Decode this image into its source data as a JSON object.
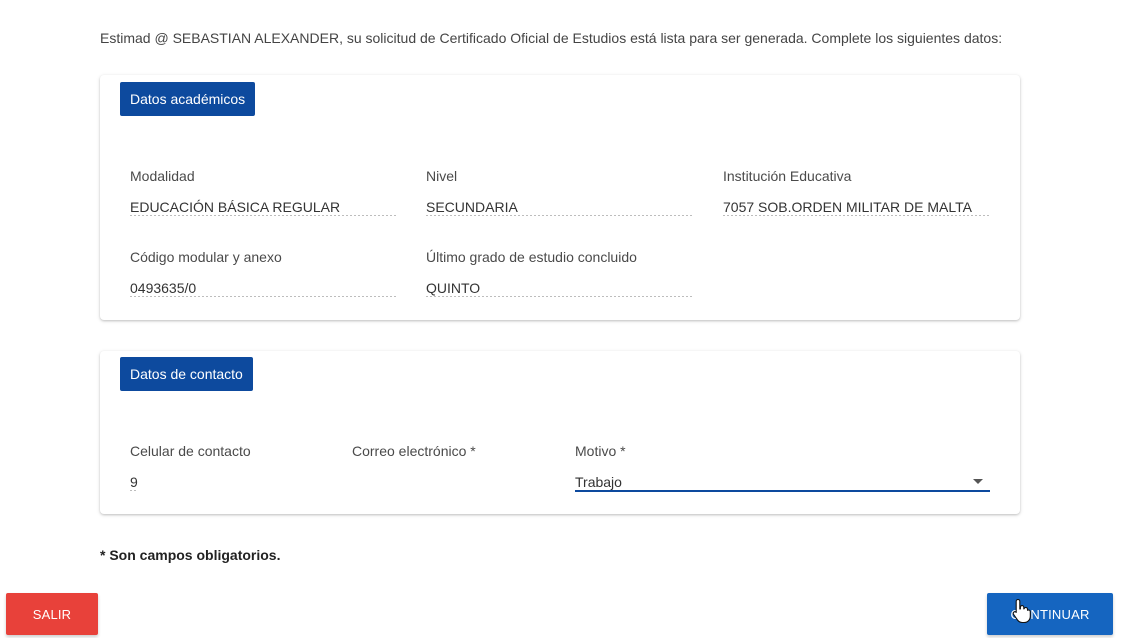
{
  "intro_text": "Estimad @ SEBASTIAN ALEXANDER, su solicitud de Certificado Oficial de Estudios está lista para ser generada. Complete los siguientes datos:",
  "academic": {
    "title": "Datos académicos",
    "fields": {
      "modalidad": {
        "label": "Modalidad",
        "value": "EDUCACIÓN BÁSICA REGULAR"
      },
      "nivel": {
        "label": "Nivel",
        "value": "SECUNDARIA"
      },
      "institucion": {
        "label": "Institución Educativa",
        "value": "7057 SOB.ORDEN MILITAR DE MALTA"
      },
      "codigo": {
        "label": "Código modular y anexo",
        "value": "0493635/0"
      },
      "grado": {
        "label": "Último grado de estudio concluido",
        "value": "QUINTO"
      }
    }
  },
  "contact": {
    "title": "Datos de contacto",
    "fields": {
      "celular": {
        "label": "Celular de contacto",
        "value": "9"
      },
      "correo": {
        "label": "Correo electrónico *",
        "value": ""
      },
      "motivo": {
        "label": "Motivo *",
        "value": "Trabajo",
        "icon": "chevron-down-icon"
      }
    }
  },
  "required_note": "* Son campos obligatorios.",
  "buttons": {
    "exit": "SALIR",
    "continue": "CONTINUAR"
  },
  "colors": {
    "primary": "#0d4a9e",
    "continue": "#1565c0",
    "exit": "#e8413a"
  }
}
